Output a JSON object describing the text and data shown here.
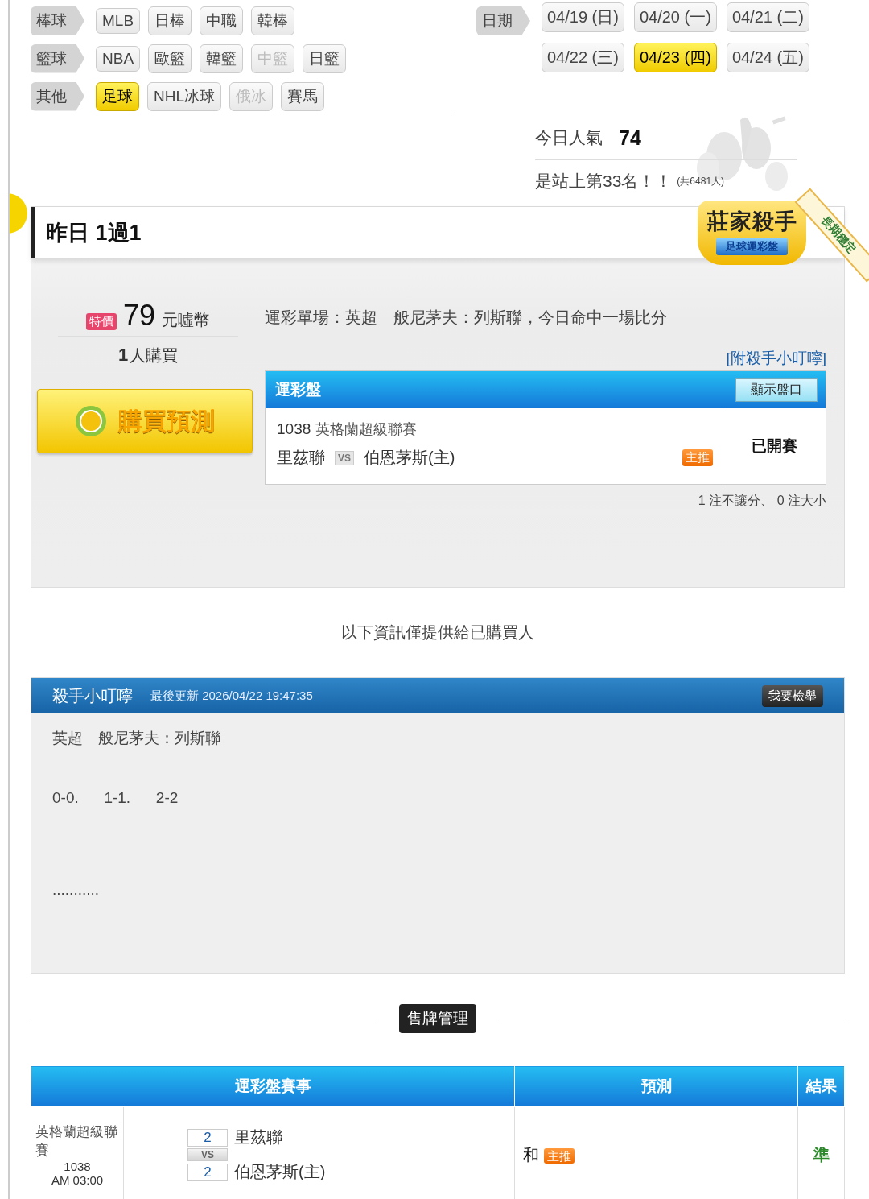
{
  "sport_groups": [
    {
      "label": "棒球",
      "items": [
        {
          "label": "MLB",
          "selected": false,
          "disabled": false
        },
        {
          "label": "日棒",
          "selected": false,
          "disabled": false
        },
        {
          "label": "中職",
          "selected": false,
          "disabled": false
        },
        {
          "label": "韓棒",
          "selected": false,
          "disabled": false
        }
      ]
    },
    {
      "label": "籃球",
      "items": [
        {
          "label": "NBA",
          "selected": false,
          "disabled": false
        },
        {
          "label": "歐籃",
          "selected": false,
          "disabled": false
        },
        {
          "label": "韓籃",
          "selected": false,
          "disabled": false
        },
        {
          "label": "中籃",
          "selected": false,
          "disabled": true
        },
        {
          "label": "日籃",
          "selected": false,
          "disabled": false
        }
      ]
    },
    {
      "label": "其他",
      "items": [
        {
          "label": "足球",
          "selected": true,
          "disabled": false
        },
        {
          "label": "NHL冰球",
          "selected": false,
          "disabled": false
        },
        {
          "label": "俄冰",
          "selected": false,
          "disabled": true
        },
        {
          "label": "賽馬",
          "selected": false,
          "disabled": false
        }
      ]
    }
  ],
  "date_filter": {
    "label": "日期",
    "dates": [
      {
        "label": "04/19 (日)",
        "selected": false
      },
      {
        "label": "04/20 (一)",
        "selected": false
      },
      {
        "label": "04/21 (二)",
        "selected": false
      },
      {
        "label": "04/22 (三)",
        "selected": false
      },
      {
        "label": "04/23 (四)",
        "selected": true
      },
      {
        "label": "04/24 (五)",
        "selected": false
      }
    ]
  },
  "popularity": {
    "label": "今日人氣",
    "value": "74",
    "rank": "是站上第33名！！",
    "total": "(共6481人)"
  },
  "badge": {
    "title": "莊家殺手",
    "subtitle": "足球運彩盤",
    "ribbon": "長期穩定"
  },
  "record": {
    "title": "昨日 1過1"
  },
  "offer": {
    "tag": "特價",
    "price": "79",
    "unit": "元噓幣",
    "buyers_count": "1",
    "buyers_label": "人購買",
    "buy_button": "購買預測"
  },
  "description": "運彩單場：英超　般尼茅夫：列斯聯，今日命中一場比分",
  "tips_link": "[附殺手小叮嚀]",
  "game_box": {
    "title": "運彩盤",
    "toggle": "顯示盤口",
    "game_no": "1038",
    "league": "英格蘭超級聯賽",
    "away": "里茲聯",
    "vs": "VS",
    "home": "伯恩茅斯(主)",
    "tag": "主推",
    "status": "已開賽"
  },
  "pick_summary": "1 注不讓分、 0 注大小",
  "notice": "以下資訊僅提供給已購買人",
  "tips": {
    "title": "殺手小叮嚀",
    "updated": "最後更新 2026/04/22 19:47:35",
    "report_button": "我要檢舉",
    "lines": [
      "英超　般尼茅夫：列斯聯",
      "0-0.      1-1.      2-2",
      "..........."
    ]
  },
  "sales_button": "售牌管理",
  "results_table": {
    "columns": [
      "運彩盤賽事",
      "預測",
      "結果"
    ],
    "rows": [
      {
        "league": "英格蘭超級聯賽",
        "game_no": "1038",
        "time": "AM 03:00",
        "away_score": "2",
        "vs": "VS",
        "home_score": "2",
        "away": "里茲聯",
        "home": "伯恩茅斯(主)",
        "prediction": "和",
        "tag": "主推",
        "result": "準"
      }
    ]
  }
}
